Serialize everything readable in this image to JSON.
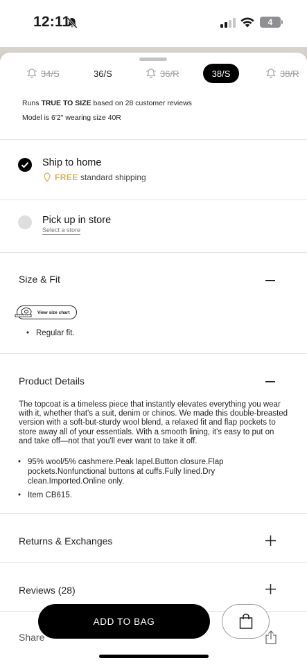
{
  "status_bar": {
    "time": "12:11",
    "battery": "4"
  },
  "sizes": [
    {
      "label": "34/S",
      "state": "unavailable"
    },
    {
      "label": "36/S",
      "state": "available"
    },
    {
      "label": "36/R",
      "state": "unavailable"
    },
    {
      "label": "38/S",
      "state": "selected"
    },
    {
      "label": "38/R",
      "state": "unavailable"
    }
  ],
  "fit_note": {
    "prefix": "Runs ",
    "highlight": "TRUE TO SIZE",
    "suffix": " based on 28 customer reviews",
    "model": "Model is 6'2\" wearing size 40R"
  },
  "shipping": {
    "ship_home": {
      "title": "Ship to home",
      "free": "FREE",
      "detail": "standard shipping",
      "selected": true
    },
    "pickup": {
      "title": "Pick up in store",
      "link": "Select a store",
      "selected": false
    }
  },
  "size_fit": {
    "title": "Size & Fit",
    "chart_button": "View size chart",
    "bullets": [
      "Regular fit."
    ]
  },
  "product_details": {
    "title": "Product Details",
    "description": "The topcoat is a timeless piece that instantly elevates everything you wear with it, whether that's a suit, denim or chinos. We made this double-breasted version with a soft-but-sturdy wool blend, a relaxed fit and flap pockets to store away all of your essentials. With a smooth lining, it's easy to put on and take off—not that you'll ever want to take it off.",
    "bullets": [
      "95% wool/5% cashmere.Peak lapel.Button closure.Flap pockets.Nonfunctional buttons at cuffs.Fully lined.Dry clean.Imported.Online only.",
      "Item CB615."
    ]
  },
  "returns": {
    "title": "Returns & Exchanges"
  },
  "reviews": {
    "title": "Reviews (28)"
  },
  "share": {
    "title": "Share"
  },
  "cta": {
    "add_to_bag": "ADD TO BAG"
  },
  "colors": {
    "accent": "#000000",
    "free": "#d9b24a",
    "divider": "#e3e3e3"
  }
}
